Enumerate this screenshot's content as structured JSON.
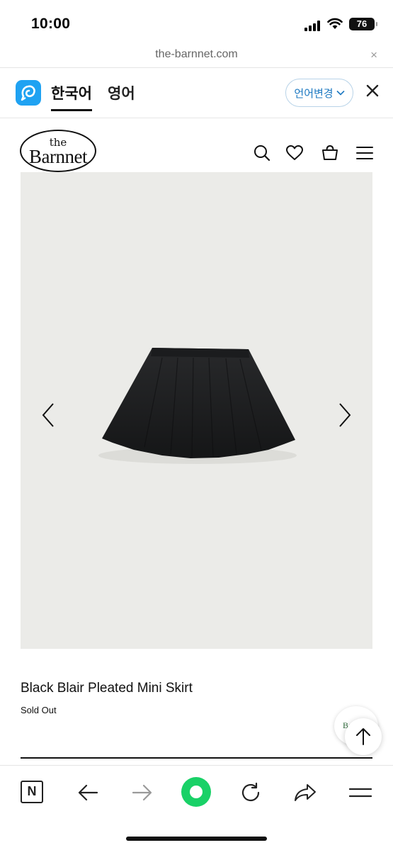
{
  "status_bar": {
    "time": "10:00",
    "battery": "76"
  },
  "browser": {
    "url": "the-barnnet.com",
    "close_glyph": "×"
  },
  "translate_bar": {
    "icon": "papago-icon",
    "tabs": [
      {
        "label": "한국어",
        "active": true
      },
      {
        "label": "영어",
        "active": false
      }
    ],
    "change_label": "언어변경"
  },
  "site_header": {
    "logo_small": "the",
    "logo_main": "Barnnet",
    "icons": [
      "search-icon",
      "heart-icon",
      "bag-icon",
      "menu-icon"
    ]
  },
  "product": {
    "name": "Black Blair Pleated Mini Skirt",
    "status": "Sold Out",
    "image_background": "#ebebe8",
    "skirt_color": "#1c1d1f"
  },
  "floating_badge_text": "Ba",
  "toolbar": {
    "items": [
      "naver-icon",
      "back-arrow-icon",
      "forward-arrow-icon",
      "green-circle-icon",
      "reload-icon",
      "share-icon",
      "menu-icon"
    ],
    "naver_letter": "N"
  },
  "colors": {
    "accent_blue": "#1d79c2",
    "green": "#19d167"
  }
}
